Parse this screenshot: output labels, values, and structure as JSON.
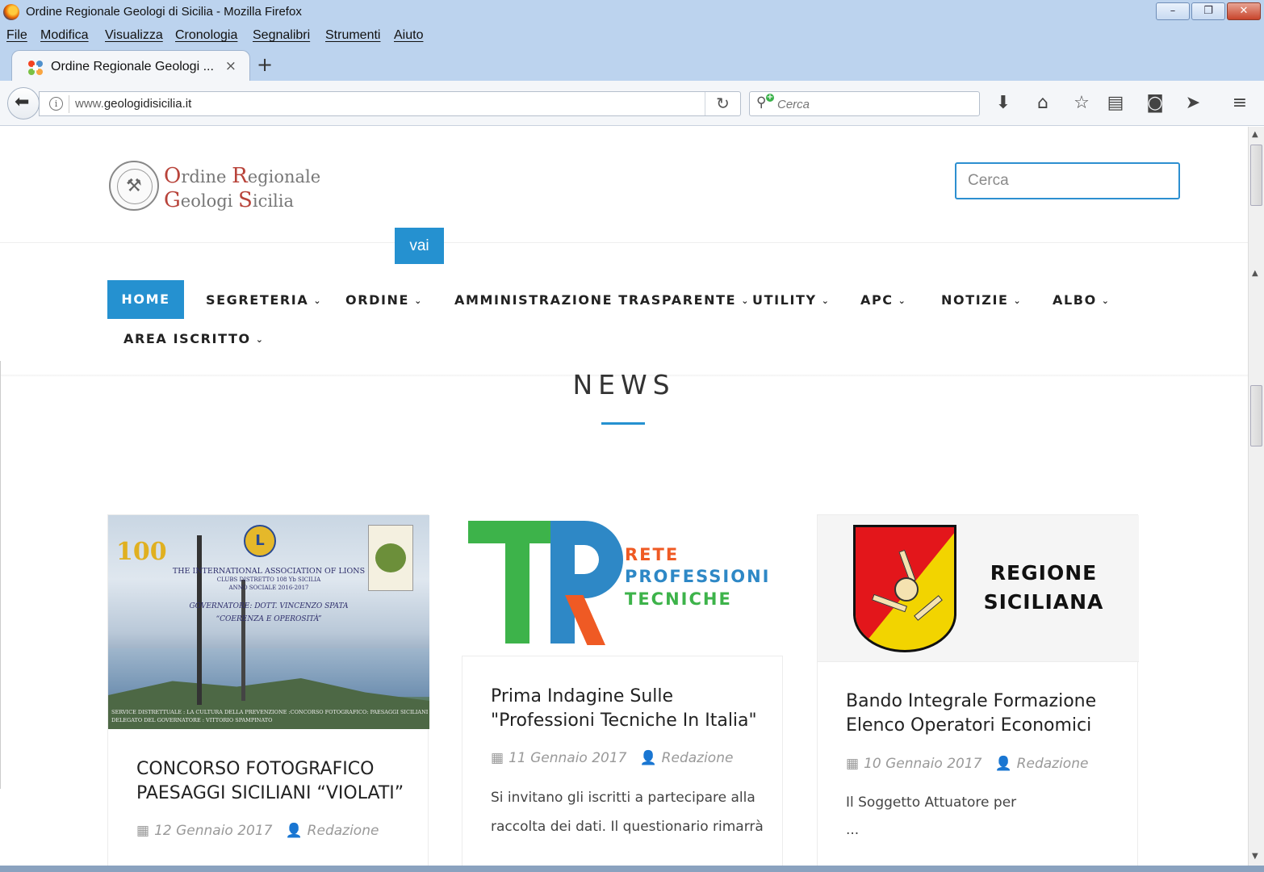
{
  "window": {
    "title": "Ordine Regionale Geologi di Sicilia - Mozilla Firefox",
    "buttons": {
      "minimize": "–",
      "restore": "❐",
      "close": "✕"
    }
  },
  "menu": [
    "File",
    "Modifica",
    "Visualizza",
    "Cronologia",
    "Segnalibri",
    "Strumenti",
    "Aiuto"
  ],
  "tab": {
    "title": "Ordine Regionale Geologi ...",
    "close": "×",
    "new": "+"
  },
  "navbar": {
    "url_prefix": "www.",
    "url_domain": "geologidisicilia.it",
    "search_placeholder": "Cerca",
    "icons": [
      "back-arrow-icon",
      "info-icon",
      "reload-icon",
      "download-icon",
      "home-icon",
      "bookmark-star-icon",
      "reading-list-icon",
      "pocket-icon",
      "send-icon",
      "hamburger-menu-icon"
    ]
  },
  "site": {
    "logo_line1_cap1": "O",
    "logo_line1_rest1": "rdine ",
    "logo_line1_cap2": "R",
    "logo_line1_rest2": "egionale",
    "logo_line2_cap1": "G",
    "logo_line2_rest1": "eologi ",
    "logo_line2_cap2": "S",
    "logo_line2_rest2": "icilia",
    "search_placeholder": "Cerca",
    "search_button": "vai",
    "accent_color": "#2591d0"
  },
  "mainmenu": {
    "home": "HOME",
    "items": [
      {
        "label": "SEGRETERIA",
        "chevron": "⌄"
      },
      {
        "label": "ORDINE",
        "chevron": "⌄"
      },
      {
        "label": "AMMINISTRAZIONE TRASPARENTE",
        "chevron": "⌄"
      },
      {
        "label": "UTILITY",
        "chevron": "⌄"
      },
      {
        "label": "APC",
        "chevron": "⌄"
      },
      {
        "label": "NOTIZIE",
        "chevron": "⌄"
      },
      {
        "label": "ALBO",
        "chevron": "⌄"
      },
      {
        "label": "AREA ISCRITTO",
        "chevron": "⌄"
      }
    ]
  },
  "news": {
    "heading": "NEWS",
    "cards": [
      {
        "title": "CONCORSO FOTOGRAFICO PAESAGGI SICILIANI “VIOLATI”",
        "date": "12 Gennaio 2017",
        "author": "Redazione",
        "image_text": {
          "hundred": "100",
          "lions": "L",
          "line1": "THE INTERNATIONAL ASSOCIATION OF LIONS",
          "line2": "CLUBS DISTRETTO 108 Yb SICILIA",
          "line3": "ANNO SOCIALE 2016-2017",
          "line4": "GOVERNATORE: DOTT. VINCENZO SPATA",
          "line5": "“COERENZA E OPEROSITÀ”",
          "foot1": "SERVICE DISTRETTUALE : LA CULTURA DELLA PREVENZIONE :CONCORSO FOTOGRAFICO: PAESAGGI SICILIANI “ VIOLATI”",
          "foot2": "DELEGATO DEL GOVERNATORE : VITTORIO SPAMPINATO"
        }
      },
      {
        "title": "Prima Indagine Sulle \"Professioni Tecniche In Italia\"",
        "date": "11 Gennaio 2017",
        "author": "Redazione",
        "excerpt": "Si invitano gli iscritti a partecipare alla raccolta dei dati. Il questionario rimarrà",
        "logo_lines": [
          "RETE",
          "PROFESSIONI",
          "TECNICHE"
        ]
      },
      {
        "title": "Bando Integrale Formazione Elenco Operatori Economici",
        "date": "10 Gennaio 2017",
        "author": "Redazione",
        "excerpt": "Il Soggetto Attuatore per",
        "ellipsis": "...",
        "logo_lines": [
          "REGIONE",
          "SICILIANA"
        ]
      }
    ]
  }
}
